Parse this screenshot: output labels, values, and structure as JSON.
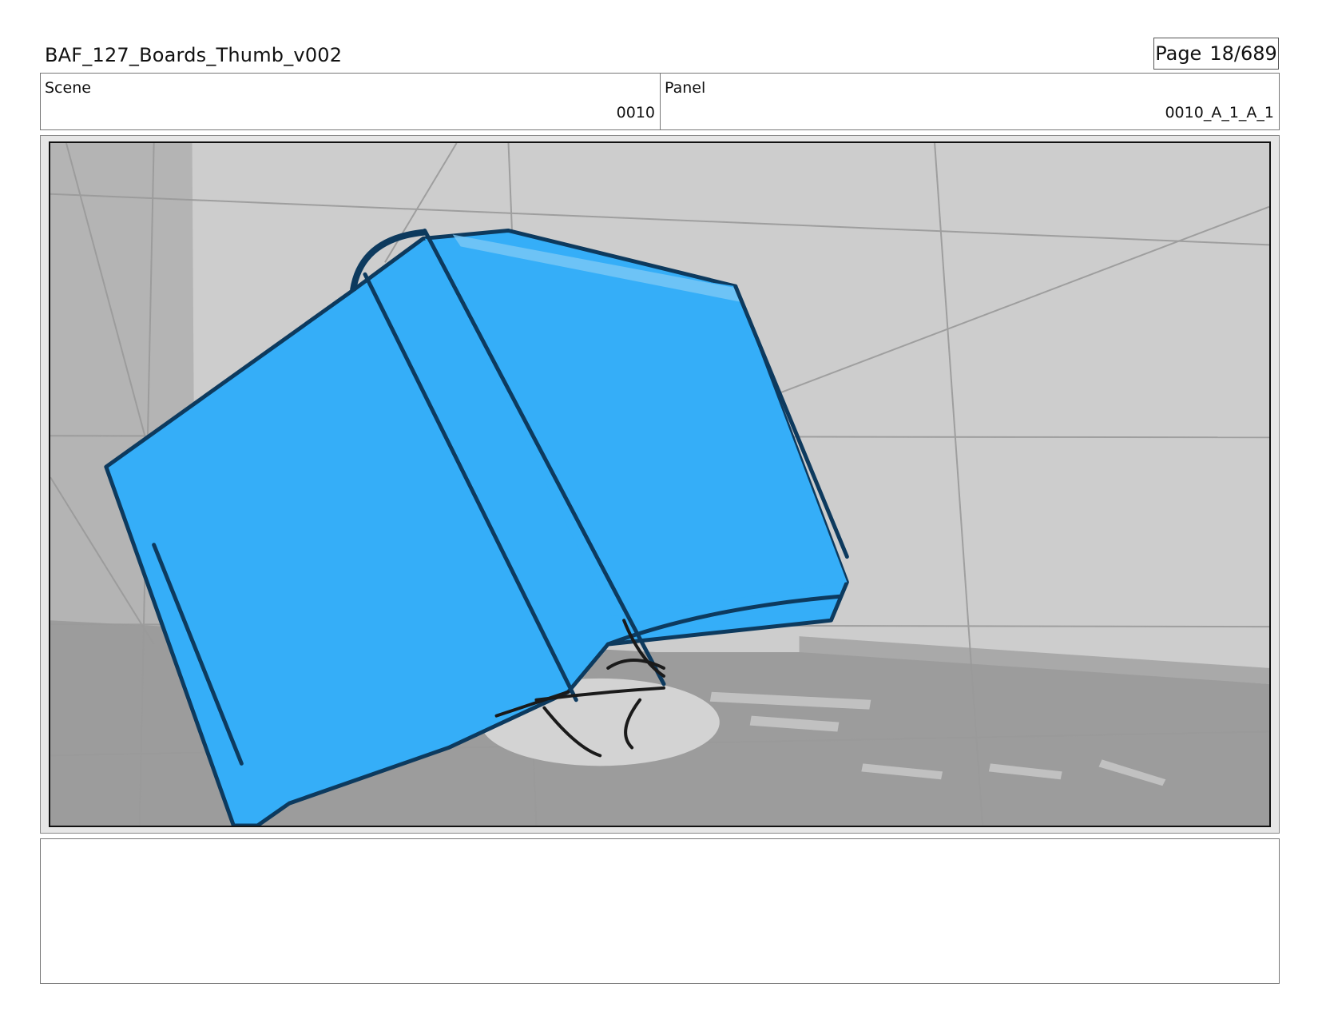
{
  "header": {
    "title": "BAF_127_Boards_Thumb_v002",
    "page_label": "Page",
    "page_value": "18/689"
  },
  "info": {
    "scene_label": "Scene",
    "scene_value": "0010",
    "panel_label": "Panel",
    "panel_value": "0010_A_1_A_1"
  },
  "artwork": {
    "description_icon": "storyboard-sketch-icon",
    "colors": {
      "wall": "#cdcdcd",
      "wall_shadow": "#b4b4b4",
      "floor": "#9a9a9a",
      "box_fill": "#35aef8",
      "box_outline": "#0d3a5e",
      "ink": "#1a1a1a"
    }
  },
  "notes": {
    "text": ""
  }
}
